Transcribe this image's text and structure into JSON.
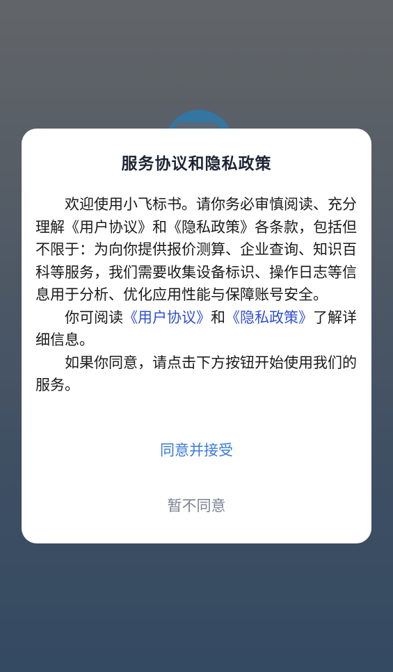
{
  "dialog": {
    "title": "服务协议和隐私政策",
    "paragraph1": "欢迎使用小飞标书。请你务必审慎阅读、充分理解《用户协议》和《隐私政策》各条款，包括但不限于：为向你提供报价测算、企业查询、知识百科等服务，我们需要收集设备标识、操作日志等信息用于分析、优化应用性能与保障账号安全。",
    "paragraph2_prefix": "你可阅读",
    "user_agreement_link": "《用户协议》",
    "paragraph2_and": "和",
    "privacy_policy_link": "《隐私政策》",
    "paragraph2_suffix": "了解详细信息。",
    "paragraph3": "如果你同意，请点击下方按钮开始使用我们的服务。",
    "agree_label": "同意并接受",
    "decline_label": "暂不同意"
  },
  "colors": {
    "link": "#2f4fd0",
    "agree": "#3a7bd5",
    "decline": "#7a8290"
  }
}
